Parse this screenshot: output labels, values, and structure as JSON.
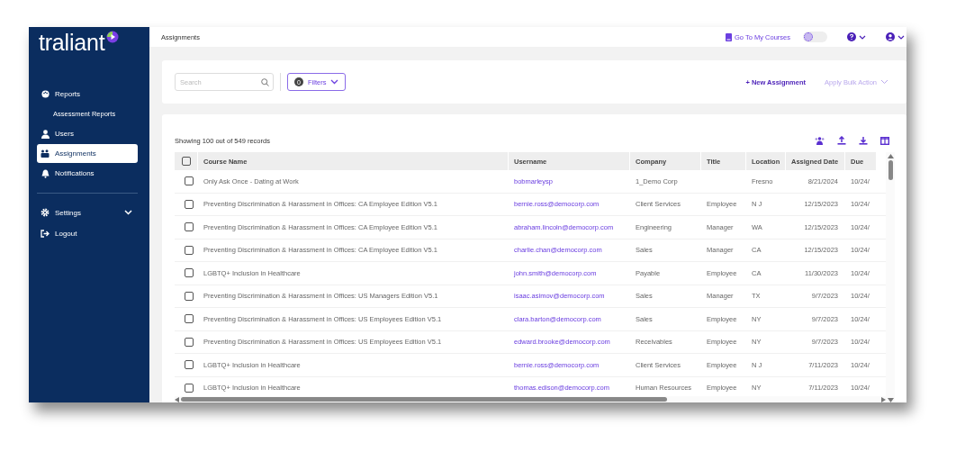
{
  "brand": {
    "name": "traliant"
  },
  "sidebar": {
    "items": [
      {
        "label": "Reports",
        "selected": false,
        "children": [
          {
            "label": "Assessment Reports",
            "selected": false
          }
        ]
      },
      {
        "label": "Users",
        "selected": false
      },
      {
        "label": "Assignments",
        "selected": true
      },
      {
        "label": "Notifications",
        "selected": false
      }
    ],
    "bottom_items": [
      {
        "label": "Settings",
        "kind": "expandable",
        "expanded": false
      },
      {
        "label": "Logout",
        "kind": "link"
      }
    ]
  },
  "top_bar": {
    "breadcrumb": "Assignments",
    "courses_link": "Go To My Courses",
    "theme_toggle": {
      "on": false
    }
  },
  "toolbar": {
    "search": {
      "placeholder": "Search"
    },
    "filters": {
      "count": "0",
      "label": "Filters"
    },
    "new_button": "+ New Assignment",
    "bulk_action": {
      "label": "Apply Bulk Action",
      "disabled": true
    }
  },
  "records_text": "Showing 100 out of 549 records",
  "table": {
    "all_checked": false,
    "columns": [
      "Course Name",
      "Username",
      "Company",
      "Title",
      "Location",
      "Assigned Date",
      "Due"
    ],
    "rows": [
      {
        "checked": false,
        "cells": [
          "Only Ask Once - Dating at Work",
          "bobmarleysp",
          "1_Demo Corp",
          "",
          "Fresno",
          "8/21/2024",
          "10/24/"
        ]
      },
      {
        "checked": false,
        "cells": [
          "Preventing Discrimination & Harassment in Offices: CA Employee Edition V5.1",
          "bernie.ross@democorp.com",
          "Client Services",
          "Employee",
          "N J",
          "12/15/2023",
          "10/24/"
        ]
      },
      {
        "checked": false,
        "cells": [
          "Preventing Discrimination & Harassment in Offices: CA Employee Edition V5.1",
          "abraham.lincoln@democorp.com",
          "Engineering",
          "Manager",
          "WA",
          "12/15/2023",
          "10/24/"
        ]
      },
      {
        "checked": false,
        "cells": [
          "Preventing Discrimination & Harassment in Offices: CA Employee Edition V5.1",
          "charlie.chan@democorp.com",
          "Sales",
          "Manager",
          "CA",
          "12/15/2023",
          "10/24/"
        ]
      },
      {
        "checked": false,
        "cells": [
          "LGBTQ+ Inclusion in Healthcare",
          "john.smith@democorp.com",
          "Payable",
          "Employee",
          "CA",
          "11/30/2023",
          "10/24/"
        ]
      },
      {
        "checked": false,
        "cells": [
          "Preventing Discrimination & Harassment in Offices: US Managers Edition V5.1",
          "isaac.asimov@democorp.com",
          "Sales",
          "Manager",
          "TX",
          "9/7/2023",
          "10/24/"
        ]
      },
      {
        "checked": false,
        "cells": [
          "Preventing Discrimination & Harassment in Offices: US Employees Edition V5.1",
          "clara.barton@democorp.com",
          "Sales",
          "Employee",
          "NY",
          "9/7/2023",
          "10/24/"
        ]
      },
      {
        "checked": false,
        "cells": [
          "Preventing Discrimination & Harassment in Offices: US Employees Edition V5.1",
          "edward.brooke@democorp.com",
          "Receivables",
          "Employee",
          "NY",
          "9/7/2023",
          "10/24/"
        ]
      },
      {
        "checked": false,
        "cells": [
          "LGBTQ+ Inclusion in Healthcare",
          "bernie.ross@democorp.com",
          "Client Services",
          "Employee",
          "N J",
          "7/11/2023",
          "10/24/"
        ]
      },
      {
        "checked": false,
        "cells": [
          "LGBTQ+ Inclusion in Healthcare",
          "thomas.edison@democorp.com",
          "Human Resources",
          "Employee",
          "NY",
          "7/11/2023",
          "10/24/"
        ]
      }
    ]
  }
}
